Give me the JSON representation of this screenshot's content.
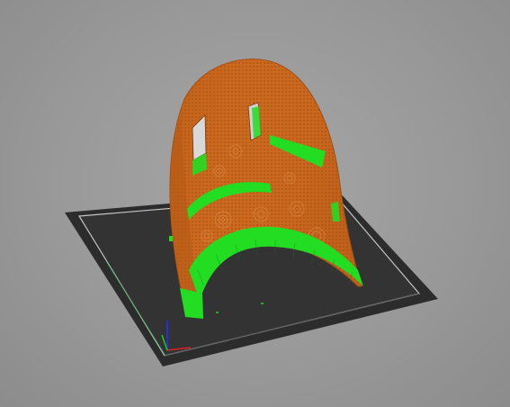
{
  "viewport": {
    "background_color": "#9a9a9a",
    "bed_color": "#2c2c2c",
    "bed_outline_color": "#c8c8c8",
    "model_color": "#cc6a1e",
    "model_shade_color": "#9e4a10",
    "support_color": "#22dd22",
    "axes": {
      "x_color": "#e02020",
      "y_color": "#20c020",
      "z_color": "#2030ff"
    }
  },
  "scene": {
    "object": "shell-model",
    "view": "preview",
    "support_material": true
  }
}
